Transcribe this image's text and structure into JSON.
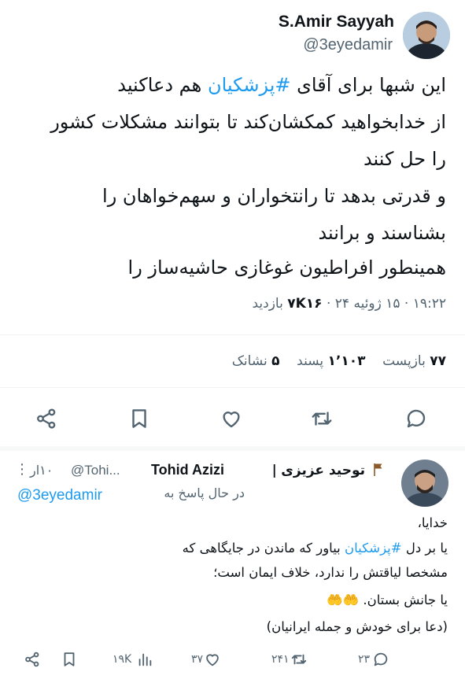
{
  "main_tweet": {
    "author_name": "S.Amir Sayyah",
    "author_handle": "@3eyedamir",
    "text_lines": [
      {
        "pre": "این شبها برای آقای ",
        "tag": "#پزشکیان",
        "post": " هم دعاکنید"
      },
      {
        "pre": "از خدابخواهید کمکشان‌کند تا بتوانند مشکلات کشور",
        "tag": "",
        "post": ""
      },
      {
        "pre": "را حل کنند",
        "tag": "",
        "post": ""
      },
      {
        "pre": "و قدرتی بدهد تا رانتخواران و سهم‌خواهان را",
        "tag": "",
        "post": ""
      },
      {
        "pre": "بشناسند و برانند",
        "tag": "",
        "post": ""
      },
      {
        "pre": "همینطور افراطیون غوغازی حاشیه‌ساز را",
        "tag": "",
        "post": ""
      }
    ],
    "meta": {
      "time": "۱۹:۲۲",
      "date": "۱۵ ژوئیه ۲۴",
      "views_count": "۷K۱۶",
      "views_label": "بازدید"
    },
    "stats": {
      "retweets_count": "۷۷",
      "retweets_label": "بازپست",
      "likes_count": "۱٬۱۰۳",
      "likes_label": "پسند",
      "bookmarks_count": "۵",
      "bookmarks_label": "نشانک"
    }
  },
  "reply": {
    "name_fa": "توحید عزیزی",
    "name_en": "Tohid Azizi",
    "separator": "|",
    "handle": "@Tohi...",
    "time": "۱۰ار",
    "more": "⋮",
    "replying_to_label": "در حال پاسخ به",
    "replying_to_handle": "@3eyedamir",
    "text_lines": [
      {
        "pre": "خدایا،",
        "tag": "",
        "post": ""
      },
      {
        "pre": "یا بر دل ",
        "tag": "#پزشکیان",
        "post": " بیاور که ماندن در جایگاهی که"
      },
      {
        "pre": "مشخصا لیاقتش را ندارد، خلاف ایمان است؛",
        "tag": "",
        "post": ""
      },
      {
        "pre": "یا جانش بستان. ",
        "tag": "",
        "post": "🤲🤲"
      },
      {
        "pre": "(دعا برای خودش و جمله ایرانیان)",
        "tag": "",
        "post": ""
      }
    ],
    "actions": {
      "replies": "۲۳",
      "retweets": "۲۴۱",
      "likes": "۳۷",
      "views": "۱۹K"
    }
  },
  "colors": {
    "accent": "#1d9bf0",
    "text": "#0f1419",
    "muted": "#536471",
    "divider": "#eff3f4"
  }
}
